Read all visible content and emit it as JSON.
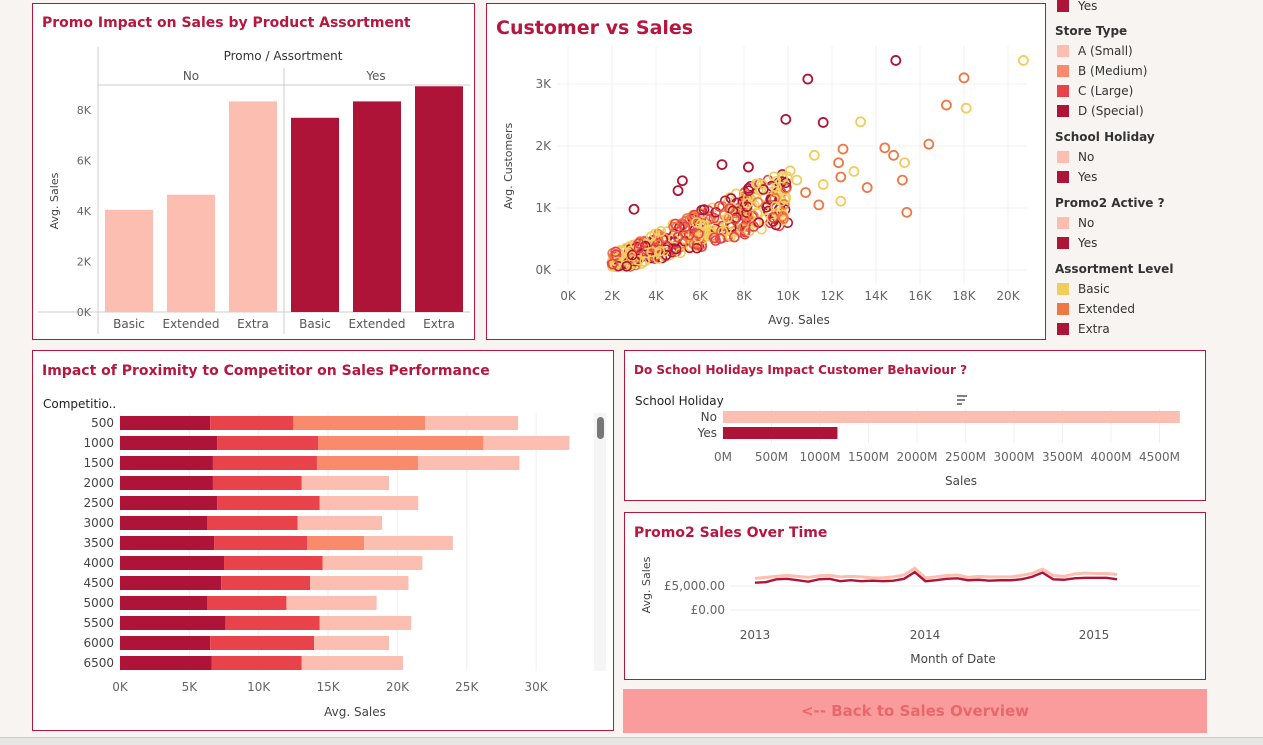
{
  "colors": {
    "accent": "#b5173f",
    "light_pink": "#fcbeb0",
    "salmon": "#f98b6c",
    "red": "#e8434b",
    "crimson": "#ae1438",
    "yellow": "#f2cd5d",
    "orange": "#ee7744",
    "button_bg": "#fa9c9c",
    "button_text": "#e8676b"
  },
  "legend": {
    "top_item": "Yes",
    "store_type": {
      "title": "Store Type",
      "items": [
        "A (Small)",
        "B (Medium)",
        "C (Large)",
        "D (Special)"
      ]
    },
    "school_holiday": {
      "title": "School Holiday",
      "items": [
        "No",
        "Yes"
      ]
    },
    "promo2": {
      "title": "Promo2 Active ?",
      "items": [
        "No",
        "Yes"
      ]
    },
    "assortment": {
      "title": "Assortment Level",
      "items": [
        "Basic",
        "Extended",
        "Extra"
      ]
    }
  },
  "promo": {
    "title": "Promo Impact on Sales by Product Assortment",
    "header": "Promo / Assortment",
    "groups": [
      "No",
      "Yes"
    ],
    "ylabel": "Avg. Sales",
    "yticks": [
      "0K",
      "2K",
      "4K",
      "6K",
      "8K"
    ]
  },
  "scatter": {
    "title": "Customer vs Sales",
    "xlabel": "Avg. Sales",
    "ylabel": "Avg. Customers",
    "xticks": [
      "0K",
      "2K",
      "4K",
      "6K",
      "8K",
      "10K",
      "12K",
      "14K",
      "16K",
      "18K",
      "20K"
    ],
    "yticks": [
      "0K",
      "1K",
      "2K",
      "3K"
    ]
  },
  "competitor": {
    "title": "Impact of Proximity to Competitor on Sales Performance",
    "col_header": "Competitio..",
    "xlabel": "Avg. Sales",
    "xticks": [
      "0K",
      "5K",
      "10K",
      "15K",
      "20K",
      "25K",
      "30K"
    ]
  },
  "holiday": {
    "title": "Do School Holidays Impact Customer Behaviour ?",
    "col_header": "School Holiday",
    "xlabel": "Sales",
    "xticks": [
      "0M",
      "500M",
      "1000M",
      "1500M",
      "2000M",
      "2500M",
      "3000M",
      "3500M",
      "4000M",
      "4500M"
    ]
  },
  "promo2": {
    "title": "Promo2 Sales Over Time",
    "xlabel": "Month of Date",
    "ylabel": "Avg. Sales",
    "xticks": [
      "2013",
      "2014",
      "2015"
    ],
    "yticks": [
      "£0.00",
      "£5,000.00"
    ]
  },
  "back_button": "<-- Back to Sales Overview",
  "chart_data": [
    {
      "type": "bar",
      "title": "Promo Impact on Sales by Product Assortment",
      "ylabel": "Avg. Sales",
      "ylim": [
        0,
        9000
      ],
      "series": [
        {
          "name": "No",
          "categories": [
            "Basic",
            "Extended",
            "Extra"
          ],
          "values": [
            4050,
            4650,
            8350
          ]
        },
        {
          "name": "Yes",
          "categories": [
            "Basic",
            "Extended",
            "Extra"
          ],
          "values": [
            7700,
            8350,
            8950
          ]
        }
      ]
    },
    {
      "type": "scatter",
      "title": "Customer vs Sales",
      "xlabel": "Avg. Sales",
      "ylabel": "Avg. Customers",
      "xlim": [
        0,
        21000
      ],
      "ylim": [
        0,
        3500
      ],
      "points": [
        {
          "x": 14900,
          "y": 3380,
          "c": "crimson"
        },
        {
          "x": 20700,
          "y": 3380,
          "c": "yellow"
        },
        {
          "x": 10900,
          "y": 3080,
          "c": "crimson"
        },
        {
          "x": 18000,
          "y": 3100,
          "c": "orange"
        },
        {
          "x": 17200,
          "y": 2660,
          "c": "orange"
        },
        {
          "x": 18100,
          "y": 2610,
          "c": "yellow"
        },
        {
          "x": 9900,
          "y": 2430,
          "c": "crimson"
        },
        {
          "x": 11600,
          "y": 2380,
          "c": "crimson"
        },
        {
          "x": 13300,
          "y": 2390,
          "c": "yellow"
        },
        {
          "x": 16400,
          "y": 2030,
          "c": "orange"
        },
        {
          "x": 14400,
          "y": 1970,
          "c": "orange"
        },
        {
          "x": 12500,
          "y": 1950,
          "c": "orange"
        },
        {
          "x": 15300,
          "y": 1730,
          "c": "yellow"
        },
        {
          "x": 12300,
          "y": 1730,
          "c": "orange"
        },
        {
          "x": 14800,
          "y": 1850,
          "c": "orange"
        },
        {
          "x": 11200,
          "y": 1850,
          "c": "yellow"
        },
        {
          "x": 13000,
          "y": 1590,
          "c": "yellow"
        },
        {
          "x": 12400,
          "y": 1500,
          "c": "orange"
        },
        {
          "x": 15200,
          "y": 1450,
          "c": "orange"
        },
        {
          "x": 13600,
          "y": 1330,
          "c": "orange"
        },
        {
          "x": 11600,
          "y": 1380,
          "c": "yellow"
        },
        {
          "x": 15400,
          "y": 930,
          "c": "orange"
        },
        {
          "x": 12400,
          "y": 1110,
          "c": "yellow"
        },
        {
          "x": 7000,
          "y": 1700,
          "c": "crimson"
        },
        {
          "x": 8200,
          "y": 1660,
          "c": "crimson"
        },
        {
          "x": 5200,
          "y": 1440,
          "c": "crimson"
        },
        {
          "x": 5000,
          "y": 1280,
          "c": "crimson"
        },
        {
          "x": 3000,
          "y": 980,
          "c": "crimson"
        },
        {
          "x": 10400,
          "y": 1450,
          "c": "yellow"
        },
        {
          "x": 11400,
          "y": 1050,
          "c": "orange"
        },
        {
          "x": 10800,
          "y": 1250,
          "c": "orange"
        },
        {
          "x": 10100,
          "y": 1600,
          "c": "yellow"
        },
        {
          "x": 9800,
          "y": 830,
          "c": "orange"
        }
      ],
      "cluster": {
        "x_range": [
          2000,
          10000
        ],
        "y_range": [
          100,
          1500
        ],
        "colors": [
          "crimson",
          "red",
          "orange",
          "yellow"
        ]
      }
    },
    {
      "type": "bar",
      "title": "Impact of Proximity to Competitor on Sales Performance",
      "xlabel": "Avg. Sales",
      "xlim": [
        0,
        34000
      ],
      "categories": [
        "500",
        "1000",
        "1500",
        "2000",
        "2500",
        "3000",
        "3500",
        "4000",
        "4500",
        "5000",
        "5500",
        "6000",
        "6500"
      ],
      "series": [
        {
          "name": "D (Special)",
          "values": [
            6500,
            7000,
            6700,
            6700,
            7000,
            6300,
            6800,
            7500,
            7300,
            6300,
            7600,
            6500,
            6600
          ]
        },
        {
          "name": "C (Large)",
          "values": [
            6000,
            7300,
            7500,
            6400,
            7400,
            6500,
            6700,
            7100,
            6400,
            5700,
            6800,
            7500,
            6500
          ]
        },
        {
          "name": "B (Medium)",
          "values": [
            9500,
            11900,
            7300,
            0,
            0,
            0,
            4100,
            0,
            0,
            0,
            0,
            0,
            0
          ]
        },
        {
          "name": "A (Small)",
          "values": [
            6700,
            6200,
            7300,
            6300,
            7100,
            6100,
            6400,
            7200,
            7100,
            6500,
            6600,
            5400,
            7300
          ]
        }
      ]
    },
    {
      "type": "bar",
      "title": "Do School Holidays Impact Customer Behaviour ?",
      "xlabel": "Sales",
      "categories": [
        "No",
        "Yes"
      ],
      "values": [
        4710,
        1180
      ],
      "unit": "M"
    },
    {
      "type": "line",
      "title": "Promo2 Sales Over Time",
      "xlabel": "Month of Date",
      "ylabel": "Avg. Sales",
      "x_range": [
        "2013-01",
        "2015-07"
      ],
      "series": [
        {
          "name": "No",
          "values": [
            6600,
            6800,
            7000,
            7200,
            7000,
            6800,
            7100,
            7200,
            6900,
            7000,
            6900,
            6700,
            6700,
            6900,
            7300,
            8700,
            6700,
            6900,
            7200,
            7300,
            6800,
            7000,
            6900,
            6900,
            6900,
            7200,
            7600,
            8500,
            7200,
            7000,
            7500,
            7700,
            7600,
            7600,
            7400
          ]
        },
        {
          "name": "Yes",
          "values": [
            5700,
            5800,
            6400,
            6500,
            6200,
            5900,
            6400,
            6500,
            6000,
            6200,
            6000,
            6100,
            6000,
            6100,
            6500,
            7900,
            6000,
            6200,
            6500,
            6600,
            6200,
            6300,
            6100,
            6200,
            6200,
            6400,
            6900,
            7800,
            6400,
            6300,
            6600,
            6700,
            6700,
            6700,
            6400
          ]
        }
      ]
    }
  ]
}
